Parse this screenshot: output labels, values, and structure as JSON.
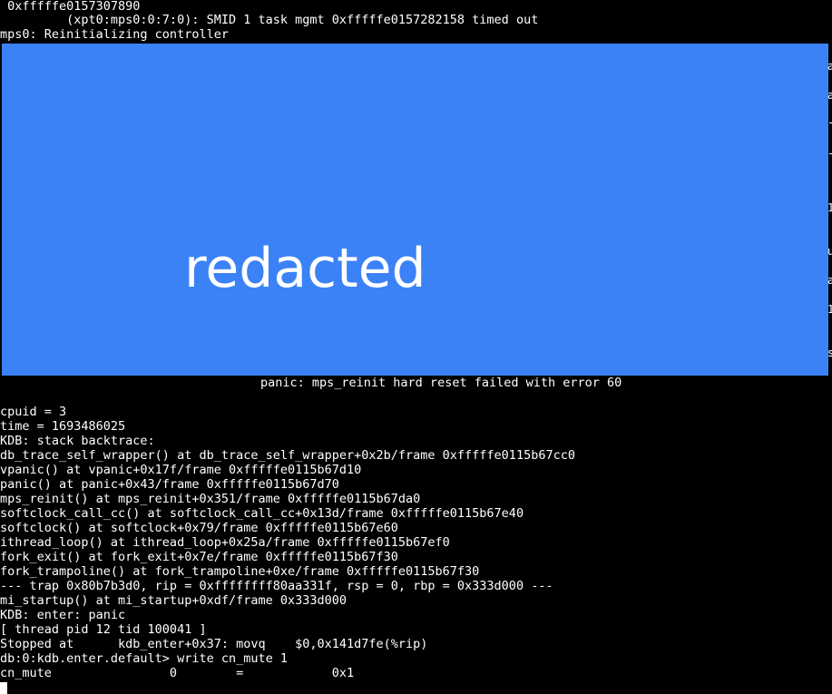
{
  "colors": {
    "background": "#000000",
    "text": "#ffffff",
    "redaction": "#3b82f6"
  },
  "console": {
    "header_lines": [
      " 0xfffffe0157307890",
      "         (xpt0:mps0:0:7:0): SMID 1 task mgmt 0xfffffe0157282158 timed out",
      "mps0: Reinitializing controller"
    ],
    "redaction_label": "redacted",
    "panic_line": "panic: mps_reinit hard reset failed with error 60",
    "trace_lines": [
      "cpuid = 3",
      "time = 1693486025",
      "KDB: stack backtrace:",
      "db_trace_self_wrapper() at db_trace_self_wrapper+0x2b/frame 0xfffffe0115b67cc0",
      "vpanic() at vpanic+0x17f/frame 0xfffffe0115b67d10",
      "panic() at panic+0x43/frame 0xfffffe0115b67d70",
      "mps_reinit() at mps_reinit+0x351/frame 0xfffffe0115b67da0",
      "softclock_call_cc() at softclock_call_cc+0x13d/frame 0xfffffe0115b67e40",
      "softclock() at softclock+0x79/frame 0xfffffe0115b67e60",
      "ithread_loop() at ithread_loop+0x25a/frame 0xfffffe0115b67ef0",
      "fork_exit() at fork_exit+0x7e/frame 0xfffffe0115b67f30",
      "fork_trampoline() at fork_trampoline+0xe/frame 0xfffffe0115b67f30",
      "--- trap 0x80b7b3d0, rip = 0xffffffff80aa331f, rsp = 0, rbp = 0x333d000 ---",
      "mi_startup() at mi_startup+0xdf/frame 0x333d000",
      "KDB: enter: panic",
      "[ thread pid 12 tid 100041 ]",
      "Stopped at      kdb_enter+0x37: movq    $0,0x141d7fe(%rip)",
      "db:0:kdb.enter.default> write cn_mute 1",
      "cn_mute                0        =            0x1"
    ],
    "edge_chars": [
      "",
      "a",
      "",
      "a",
      "",
      "-",
      "",
      "-",
      "",
      "1",
      "",
      "u",
      "",
      "a",
      "",
      "1",
      "",
      "s"
    ]
  }
}
